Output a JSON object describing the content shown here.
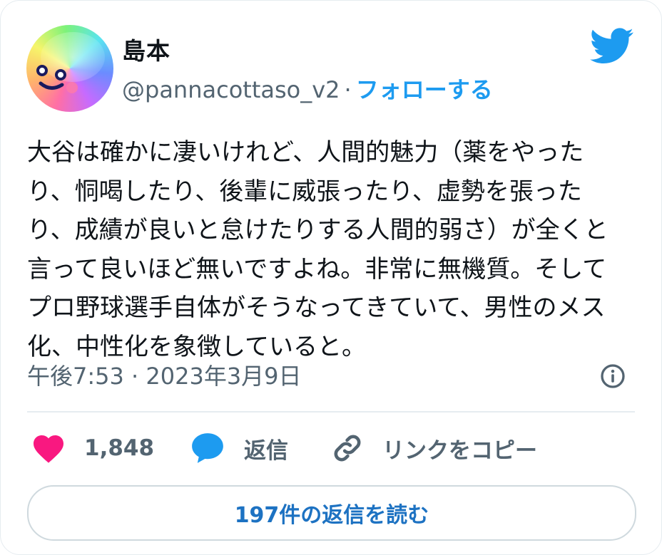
{
  "user": {
    "display_name": "島本",
    "handle": "@pannacottaso_v2",
    "separator": "·",
    "follow_label": "フォローする"
  },
  "tweet": {
    "lines": [
      "大谷は確かに凄いけれど、人間的魅力（薬をやった",
      "り、恫喝したり、後輩に威張ったり、虚勢を張った",
      "り、成績が良いと怠けたりする人間的弱さ）が全くと",
      "言って良いほど無いですよね。非常に無機質。そして",
      "プロ野球選手自体がそうなってきていて、男性のメス",
      "化、中性化を象徴していると。"
    ],
    "timestamp": "午後7:53 · 2023年3月9日"
  },
  "actions": {
    "like_count": "1,848",
    "reply_label": "返信",
    "copy_link_label": "リンクをコピー"
  },
  "footer": {
    "read_replies_label": "197件の返信を読む"
  },
  "icons": {
    "brand": "twitter-bird-icon",
    "like": "heart-icon",
    "reply": "speech-bubble-icon",
    "copy": "link-icon",
    "info": "info-icon"
  },
  "colors": {
    "accent": "#1d9bf0",
    "like": "#f91880",
    "muted": "#536471",
    "text": "#0f1419"
  }
}
